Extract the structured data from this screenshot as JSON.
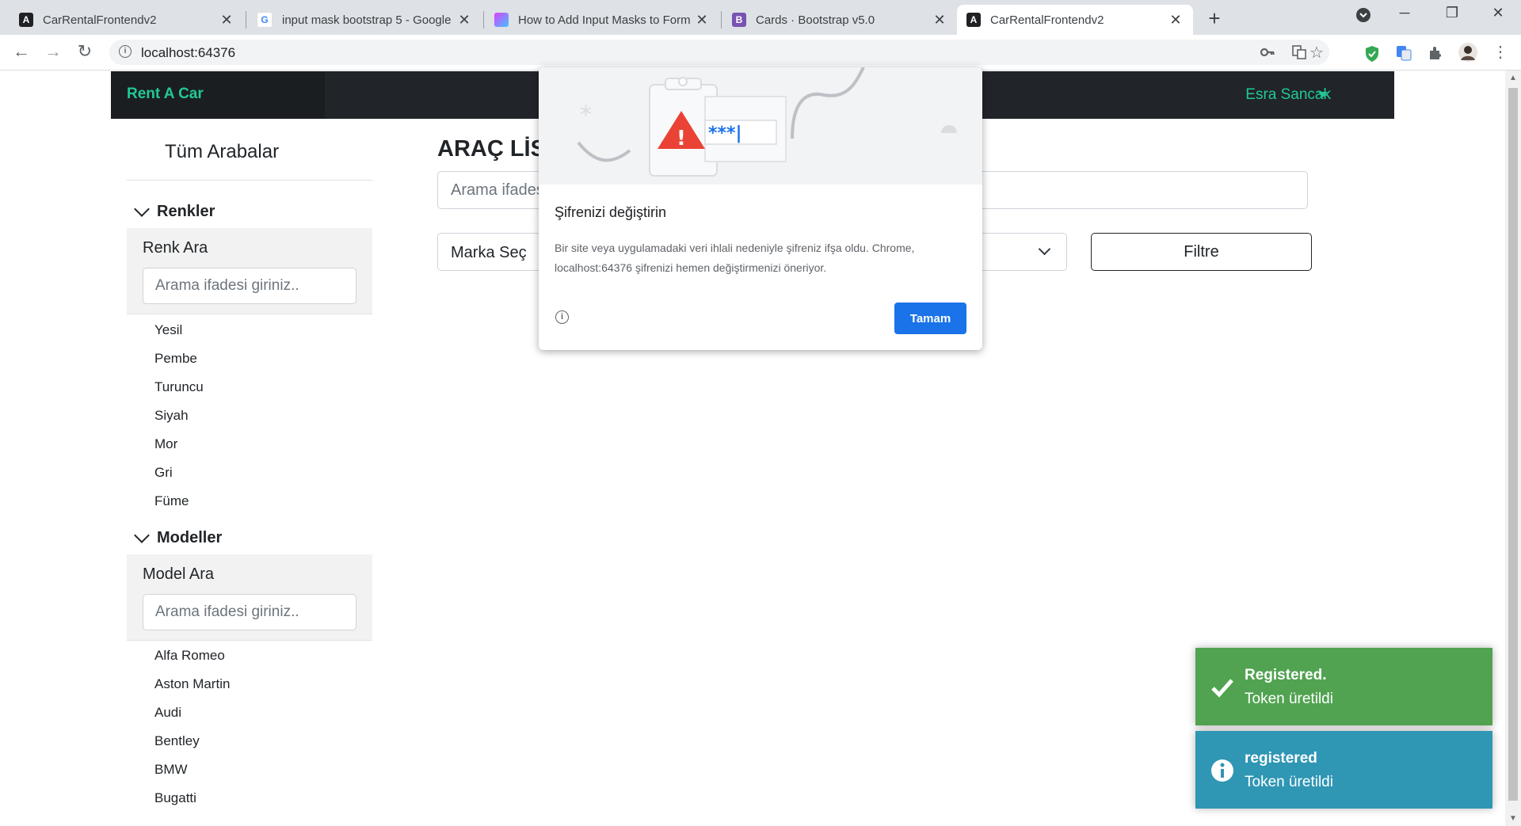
{
  "browser": {
    "tabs": [
      {
        "title": "CarRentalFrontendv2",
        "favicon": "angular-icon",
        "active": false
      },
      {
        "title": "input mask bootstrap 5 - Google",
        "favicon": "google-icon",
        "active": false
      },
      {
        "title": "How to Add Input Masks to Form",
        "favicon": "gradient-site-icon",
        "active": false
      },
      {
        "title": "Cards · Bootstrap v5.0",
        "favicon": "bootstrap-icon",
        "active": false
      },
      {
        "title": "CarRentalFrontendv2",
        "favicon": "angular-icon",
        "active": true
      }
    ],
    "url": "localhost:64376"
  },
  "navbar": {
    "brand": "Rent A Car",
    "user": "Esra Sancak",
    "accent_color": "#20c997"
  },
  "sidebar": {
    "title": "Tüm Arabalar",
    "colors_section": {
      "heading": "Renkler",
      "search_label": "Renk Ara",
      "search_placeholder": "Arama ifadesi giriniz..",
      "items": [
        "Yesil",
        "Pembe",
        "Turuncu",
        "Siyah",
        "Mor",
        "Gri",
        "Füme"
      ]
    },
    "models_section": {
      "heading": "Modeller",
      "search_label": "Model Ara",
      "search_placeholder": "Arama ifadesi giriniz..",
      "items": [
        "Alfa Romeo",
        "Aston Martin",
        "Audi",
        "Bentley",
        "BMW",
        "Bugatti"
      ]
    }
  },
  "main": {
    "title": "ARAÇ LİS",
    "search_placeholder": "Arama ifades",
    "brand_select": "Marka Seç",
    "filter_button": "Filtre"
  },
  "password_dialog": {
    "illustration_text": "***|",
    "title": "Şifrenizi değiştirin",
    "body": "Bir site veya uygulamadaki veri ihlali nedeniyle şifreniz ifşa oldu. Chrome, localhost:64376 şifrenizi hemen değiştirmenizi öneriyor.",
    "ok_button": "Tamam"
  },
  "toasts": [
    {
      "title": "Registered.",
      "message": "Token üretildi",
      "type": "success",
      "color": "#51a351"
    },
    {
      "title": "registered",
      "message": "Token üretildi",
      "type": "info",
      "color": "#2f96b4"
    }
  ]
}
